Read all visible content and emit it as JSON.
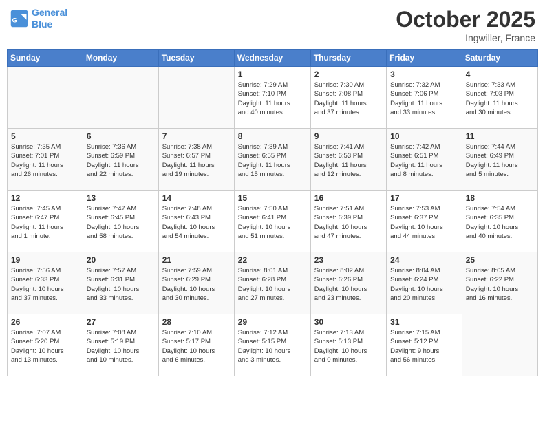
{
  "header": {
    "logo_line1": "General",
    "logo_line2": "Blue",
    "month": "October 2025",
    "location": "Ingwiller, France"
  },
  "weekdays": [
    "Sunday",
    "Monday",
    "Tuesday",
    "Wednesday",
    "Thursday",
    "Friday",
    "Saturday"
  ],
  "weeks": [
    [
      {
        "day": "",
        "info": ""
      },
      {
        "day": "",
        "info": ""
      },
      {
        "day": "",
        "info": ""
      },
      {
        "day": "1",
        "info": "Sunrise: 7:29 AM\nSunset: 7:10 PM\nDaylight: 11 hours\nand 40 minutes."
      },
      {
        "day": "2",
        "info": "Sunrise: 7:30 AM\nSunset: 7:08 PM\nDaylight: 11 hours\nand 37 minutes."
      },
      {
        "day": "3",
        "info": "Sunrise: 7:32 AM\nSunset: 7:06 PM\nDaylight: 11 hours\nand 33 minutes."
      },
      {
        "day": "4",
        "info": "Sunrise: 7:33 AM\nSunset: 7:03 PM\nDaylight: 11 hours\nand 30 minutes."
      }
    ],
    [
      {
        "day": "5",
        "info": "Sunrise: 7:35 AM\nSunset: 7:01 PM\nDaylight: 11 hours\nand 26 minutes."
      },
      {
        "day": "6",
        "info": "Sunrise: 7:36 AM\nSunset: 6:59 PM\nDaylight: 11 hours\nand 22 minutes."
      },
      {
        "day": "7",
        "info": "Sunrise: 7:38 AM\nSunset: 6:57 PM\nDaylight: 11 hours\nand 19 minutes."
      },
      {
        "day": "8",
        "info": "Sunrise: 7:39 AM\nSunset: 6:55 PM\nDaylight: 11 hours\nand 15 minutes."
      },
      {
        "day": "9",
        "info": "Sunrise: 7:41 AM\nSunset: 6:53 PM\nDaylight: 11 hours\nand 12 minutes."
      },
      {
        "day": "10",
        "info": "Sunrise: 7:42 AM\nSunset: 6:51 PM\nDaylight: 11 hours\nand 8 minutes."
      },
      {
        "day": "11",
        "info": "Sunrise: 7:44 AM\nSunset: 6:49 PM\nDaylight: 11 hours\nand 5 minutes."
      }
    ],
    [
      {
        "day": "12",
        "info": "Sunrise: 7:45 AM\nSunset: 6:47 PM\nDaylight: 11 hours\nand 1 minute."
      },
      {
        "day": "13",
        "info": "Sunrise: 7:47 AM\nSunset: 6:45 PM\nDaylight: 10 hours\nand 58 minutes."
      },
      {
        "day": "14",
        "info": "Sunrise: 7:48 AM\nSunset: 6:43 PM\nDaylight: 10 hours\nand 54 minutes."
      },
      {
        "day": "15",
        "info": "Sunrise: 7:50 AM\nSunset: 6:41 PM\nDaylight: 10 hours\nand 51 minutes."
      },
      {
        "day": "16",
        "info": "Sunrise: 7:51 AM\nSunset: 6:39 PM\nDaylight: 10 hours\nand 47 minutes."
      },
      {
        "day": "17",
        "info": "Sunrise: 7:53 AM\nSunset: 6:37 PM\nDaylight: 10 hours\nand 44 minutes."
      },
      {
        "day": "18",
        "info": "Sunrise: 7:54 AM\nSunset: 6:35 PM\nDaylight: 10 hours\nand 40 minutes."
      }
    ],
    [
      {
        "day": "19",
        "info": "Sunrise: 7:56 AM\nSunset: 6:33 PM\nDaylight: 10 hours\nand 37 minutes."
      },
      {
        "day": "20",
        "info": "Sunrise: 7:57 AM\nSunset: 6:31 PM\nDaylight: 10 hours\nand 33 minutes."
      },
      {
        "day": "21",
        "info": "Sunrise: 7:59 AM\nSunset: 6:29 PM\nDaylight: 10 hours\nand 30 minutes."
      },
      {
        "day": "22",
        "info": "Sunrise: 8:01 AM\nSunset: 6:28 PM\nDaylight: 10 hours\nand 27 minutes."
      },
      {
        "day": "23",
        "info": "Sunrise: 8:02 AM\nSunset: 6:26 PM\nDaylight: 10 hours\nand 23 minutes."
      },
      {
        "day": "24",
        "info": "Sunrise: 8:04 AM\nSunset: 6:24 PM\nDaylight: 10 hours\nand 20 minutes."
      },
      {
        "day": "25",
        "info": "Sunrise: 8:05 AM\nSunset: 6:22 PM\nDaylight: 10 hours\nand 16 minutes."
      }
    ],
    [
      {
        "day": "26",
        "info": "Sunrise: 7:07 AM\nSunset: 5:20 PM\nDaylight: 10 hours\nand 13 minutes."
      },
      {
        "day": "27",
        "info": "Sunrise: 7:08 AM\nSunset: 5:19 PM\nDaylight: 10 hours\nand 10 minutes."
      },
      {
        "day": "28",
        "info": "Sunrise: 7:10 AM\nSunset: 5:17 PM\nDaylight: 10 hours\nand 6 minutes."
      },
      {
        "day": "29",
        "info": "Sunrise: 7:12 AM\nSunset: 5:15 PM\nDaylight: 10 hours\nand 3 minutes."
      },
      {
        "day": "30",
        "info": "Sunrise: 7:13 AM\nSunset: 5:13 PM\nDaylight: 10 hours\nand 0 minutes."
      },
      {
        "day": "31",
        "info": "Sunrise: 7:15 AM\nSunset: 5:12 PM\nDaylight: 9 hours\nand 56 minutes."
      },
      {
        "day": "",
        "info": ""
      }
    ]
  ]
}
